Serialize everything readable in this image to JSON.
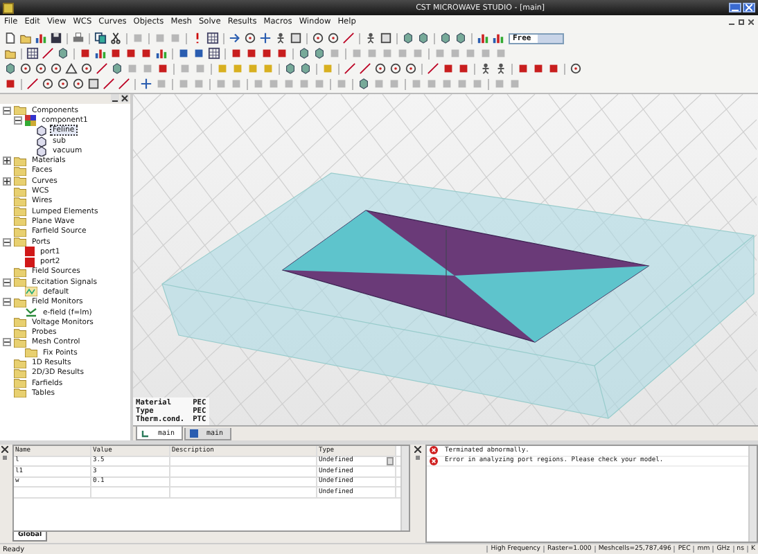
{
  "window": {
    "title": "CST MICROWAVE STUDIO - [main]"
  },
  "menu": [
    "File",
    "Edit",
    "View",
    "WCS",
    "Curves",
    "Objects",
    "Mesh",
    "Solve",
    "Results",
    "Macros",
    "Window",
    "Help"
  ],
  "toolbar": {
    "select_value": "Free"
  },
  "tree": [
    {
      "label": "Components",
      "kind": "folder",
      "expanded": true,
      "selected": false,
      "children": [
        {
          "label": "component1",
          "kind": "component",
          "expanded": true,
          "selected": false,
          "children": [
            {
              "label": "Feline",
              "kind": "solid",
              "selected": true
            },
            {
              "label": "sub",
              "kind": "solid",
              "selected": false
            },
            {
              "label": "vacuum",
              "kind": "solid",
              "selected": false
            }
          ]
        }
      ]
    },
    {
      "label": "Materials",
      "kind": "folder",
      "expanded": false,
      "selected": false
    },
    {
      "label": "Faces",
      "kind": "folder",
      "selected": false
    },
    {
      "label": "Curves",
      "kind": "folder",
      "expanded": false,
      "selected": false
    },
    {
      "label": "WCS",
      "kind": "folder",
      "selected": false
    },
    {
      "label": "Wires",
      "kind": "folder",
      "selected": false
    },
    {
      "label": "Lumped Elements",
      "kind": "folder",
      "selected": false
    },
    {
      "label": "Plane Wave",
      "kind": "folder",
      "selected": false
    },
    {
      "label": "Farfield Source",
      "kind": "folder",
      "selected": false
    },
    {
      "label": "Ports",
      "kind": "folder",
      "expanded": true,
      "selected": false,
      "children": [
        {
          "label": "port1",
          "kind": "port",
          "selected": false
        },
        {
          "label": "port2",
          "kind": "port",
          "selected": false
        }
      ]
    },
    {
      "label": "Field Sources",
      "kind": "folder",
      "selected": false
    },
    {
      "label": "Excitation Signals",
      "kind": "folder",
      "expanded": true,
      "selected": false,
      "children": [
        {
          "label": "default",
          "kind": "signal",
          "selected": false
        }
      ]
    },
    {
      "label": "Field Monitors",
      "kind": "folder",
      "expanded": true,
      "selected": false,
      "children": [
        {
          "label": "e-field (f=lm)",
          "kind": "monitor",
          "selected": false
        }
      ]
    },
    {
      "label": "Voltage Monitors",
      "kind": "folder",
      "selected": false
    },
    {
      "label": "Probes",
      "kind": "folder",
      "selected": false
    },
    {
      "label": "Mesh Control",
      "kind": "folder",
      "expanded": true,
      "selected": false,
      "children": [
        {
          "label": "Fix Points",
          "kind": "folder",
          "selected": false
        }
      ]
    },
    {
      "label": "1D Results",
      "kind": "folder",
      "selected": false
    },
    {
      "label": "2D/3D Results",
      "kind": "folder",
      "selected": false
    },
    {
      "label": "Farfields",
      "kind": "folder",
      "selected": false
    },
    {
      "label": "Tables",
      "kind": "folder",
      "selected": false
    }
  ],
  "info": [
    {
      "key": "Material",
      "value": "PEC"
    },
    {
      "key": "Type",
      "value": "PEC"
    },
    {
      "key": "Therm.cond.",
      "value": "PTC"
    }
  ],
  "view_tabs": [
    {
      "label": "main",
      "selected": true
    },
    {
      "label": "main",
      "selected": false
    }
  ],
  "parameters": {
    "columns": [
      "Name",
      "Value",
      "Description",
      "Type"
    ],
    "rows": [
      {
        "name": "l",
        "value": "3.5",
        "description": "",
        "type": "Undefined",
        "selected": true
      },
      {
        "name": "l1",
        "value": "3",
        "description": "",
        "type": "Undefined",
        "selected": false
      },
      {
        "name": "w",
        "value": "0.1",
        "description": "",
        "type": "Undefined",
        "selected": false
      },
      {
        "name": "",
        "value": "",
        "description": "",
        "type": "Undefined",
        "selected": false
      }
    ],
    "tab": "Global"
  },
  "messages": [
    {
      "kind": "error",
      "text": "Terminated abnormally."
    },
    {
      "kind": "error",
      "text": "Error in analyzing port regions. Please check your model."
    }
  ],
  "status_bar": {
    "text": "Ready",
    "fields": [
      "High Frequency",
      "Raster=1.000",
      "Meshcells=25,787,496",
      "PEC",
      "mm",
      "GHz",
      "ns",
      "K"
    ]
  }
}
